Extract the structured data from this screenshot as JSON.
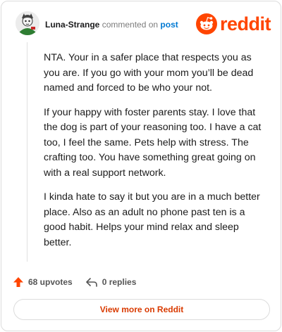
{
  "header": {
    "username": "Luna-Strange",
    "action_text": "commented on",
    "target_text": "post",
    "brand_word": "reddit"
  },
  "comment": {
    "paragraphs": [
      "NTA. Your in a safer place that respects you as you are. If you go with your mom you’ll be dead named and forced to be who your not.",
      "If your happy with foster parents stay. I love that the dog is part of your reasoning too. I have a cat too, I feel the same. Pets help with stress. The crafting too. You have something great going on with a real support network.",
      "I kinda hate to say it but you are in a much better place. Also as an adult no phone past ten is a good habit. Helps your mind relax and sleep better."
    ]
  },
  "actions": {
    "upvotes_label": "68 upvotes",
    "replies_label": "0 replies"
  },
  "footer": {
    "view_more_label": "View more on Reddit"
  },
  "colors": {
    "brand": "#ff4500",
    "link": "#0079d3",
    "view_more_text": "#d93a00"
  }
}
